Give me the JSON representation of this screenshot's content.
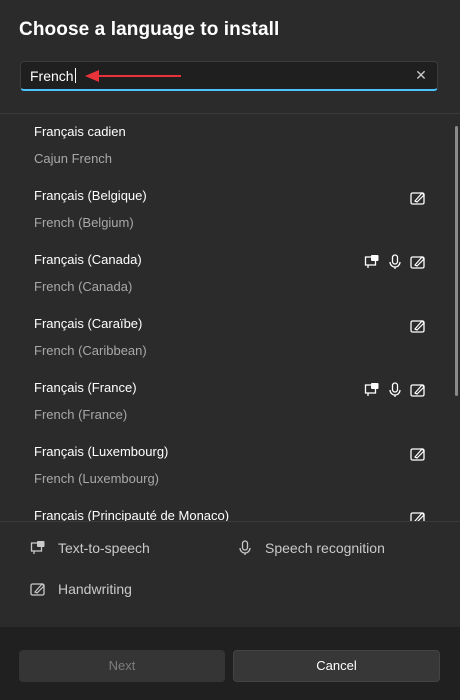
{
  "dialog": {
    "title": "Choose a language to install"
  },
  "search": {
    "value": "French"
  },
  "languages": [
    {
      "name": "Français cadien",
      "subtitle": "Cajun French",
      "features": []
    },
    {
      "name": "Français (Belgique)",
      "subtitle": "French (Belgium)",
      "features": [
        "handwriting"
      ]
    },
    {
      "name": "Français (Canada)",
      "subtitle": "French (Canada)",
      "features": [
        "text-to-speech",
        "speech-recognition",
        "handwriting"
      ]
    },
    {
      "name": "Français (Caraïbe)",
      "subtitle": "French (Caribbean)",
      "features": [
        "handwriting"
      ]
    },
    {
      "name": "Français (France)",
      "subtitle": "French (France)",
      "features": [
        "text-to-speech",
        "speech-recognition",
        "handwriting"
      ]
    },
    {
      "name": "Français (Luxembourg)",
      "subtitle": "French (Luxembourg)",
      "features": [
        "handwriting"
      ]
    },
    {
      "name": "Français (Principauté de Monaco)",
      "subtitle": "",
      "features": [
        "handwriting"
      ]
    }
  ],
  "legend": {
    "tts": "Text-to-speech",
    "speech": "Speech recognition",
    "handwriting": "Handwriting"
  },
  "buttons": {
    "next": "Next",
    "cancel": "Cancel"
  },
  "colors": {
    "accent": "#4cc2ff",
    "annotation_arrow": "#e8333b"
  }
}
